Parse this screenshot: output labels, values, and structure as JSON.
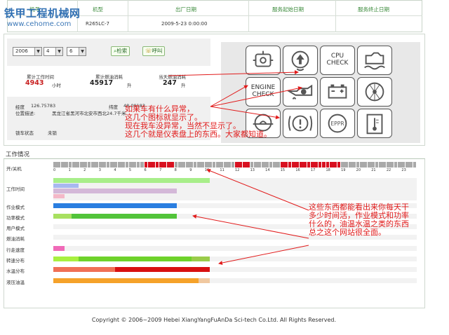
{
  "watermark": {
    "line1": "铁甲工程机械网",
    "line2": "www.cehome.com"
  },
  "top_table": {
    "headers": [
      "机号",
      "机型",
      "出厂日期",
      "服务起始日期",
      "服务终止日期"
    ],
    "row": [
      "R265LC-7",
      "2009-5-23 0:00:00",
      "",
      ""
    ]
  },
  "query": {
    "year": "2006",
    "month": "4",
    "day": "6",
    "search_label": "检索",
    "call_label": "呼叫"
  },
  "stats": {
    "work_time_label": "累计工作时间",
    "work_time_value": "4943",
    "work_time_unit": "小时",
    "fuel_label": "累计燃油消耗",
    "fuel_value": "45917",
    "fuel_unit": "升",
    "fuel_today_label": "当天燃油消耗",
    "fuel_today_value": "247",
    "fuel_today_unit": "升"
  },
  "location": {
    "lon_label": "经度",
    "lon_value": "126.75783",
    "lat_label": "纬度",
    "lat_value": "48.09183",
    "desc_label": "位置描述:",
    "desc_value": "黑龙江省黑河市北安市西北24.7千米",
    "lock_label": "锁车状态",
    "lock_value": "未锁"
  },
  "icons": {
    "cpu_check": "CPU\nCHECK",
    "engine_check": "ENGINE\nCHECK",
    "eppr": "EPPR",
    "names": [
      "engine-oil-icon",
      "boom-arrow-icon",
      "cpu-check-icon",
      "coolant-level-icon",
      "engine-check-icon",
      "oil-pressure-icon",
      "battery-icon",
      "air-filter-icon",
      "hydraulic-oil-icon",
      "warning-icon",
      "eppr-icon",
      "temperature-icon"
    ]
  },
  "work": {
    "title": "工作情况",
    "rows": [
      "开/关机",
      "工作时间",
      "作业模式",
      "功率模式",
      "用户模式",
      "燃油消耗",
      "行走速度",
      "转速分布",
      "水温分布",
      "液压油温"
    ],
    "ticks": [
      "0",
      "1",
      "2",
      "3",
      "4",
      "5",
      "6",
      "7",
      "8",
      "9",
      "10",
      "11",
      "12",
      "13",
      "14",
      "15",
      "16",
      "17",
      "18",
      "19",
      "20",
      "21",
      "22",
      "23"
    ],
    "timeline_on": [
      [
        6,
        8
      ],
      [
        12,
        13
      ],
      [
        15,
        19
      ]
    ],
    "timeline_partial": [
      [
        10,
        12
      ]
    ],
    "bars": {
      "work_time": [
        {
          "from": 0,
          "to": 0.43,
          "color": "#a8ee8a"
        },
        {
          "from": 0,
          "to": 0.07,
          "color": "#a8b8f0"
        },
        {
          "from": 0,
          "to": 0.34,
          "color": "#d4b8d8"
        },
        {
          "from": 0,
          "to": 0.03,
          "color": "#f4b8c8"
        }
      ],
      "work_mode": [
        {
          "from": 0,
          "to": 0.34,
          "color": "#2a7ee0"
        }
      ],
      "power_mode": [
        {
          "from": 0,
          "to": 0.05,
          "color": "#a8e060"
        },
        {
          "from": 0.05,
          "to": 0.34,
          "color": "#52c43a"
        }
      ],
      "travel_speed": [
        {
          "from": 0,
          "to": 0.03,
          "color": "#f06ab8"
        }
      ],
      "rpm": [
        {
          "from": 0,
          "to": 0.07,
          "color": "#a8f040"
        },
        {
          "from": 0.07,
          "to": 0.38,
          "color": "#6ed22a"
        },
        {
          "from": 0.38,
          "to": 0.43,
          "color": "#9acc4a"
        }
      ],
      "water_temp": [
        {
          "from": 0,
          "to": 0.17,
          "color": "#f07055"
        },
        {
          "from": 0.17,
          "to": 0.43,
          "color": "#d81010"
        }
      ],
      "hyd_temp": [
        {
          "from": 0,
          "to": 0.4,
          "color": "#f5a22a"
        },
        {
          "from": 0.4,
          "to": 0.43,
          "color": "#f0c8a0"
        }
      ]
    }
  },
  "annotations": {
    "a1": "如果车有什么异常，\n这几个图标就显示了。\n现在我车没异常，当然不显示了。\n这几个就是仪表盘上的东西。大家都知道。",
    "a2": "这些东西都能看出来你每天干\n多少时间活，作业模式和功率\n什么的，油温水温之类的东西\n总之这个网站很全面。"
  },
  "footer": "Copyright © 2006~2009 Hebei XiangYangFuAnDa Sci-tech Co.Ltd. All Rights Reserved."
}
